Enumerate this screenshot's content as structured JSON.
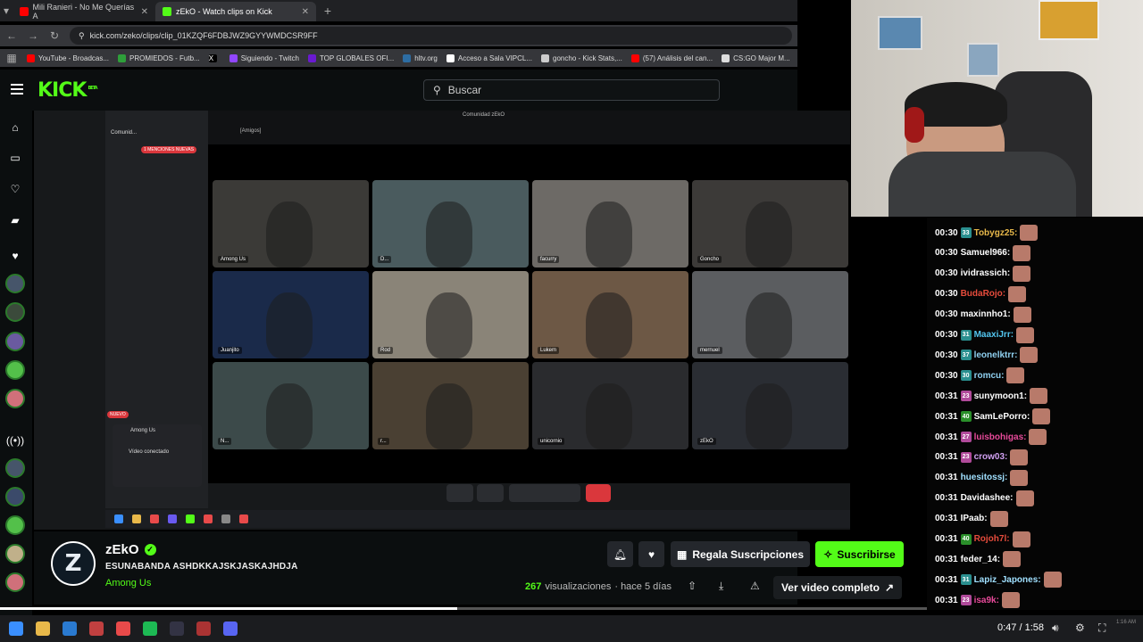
{
  "browser": {
    "tabs": [
      {
        "title": "Mili Ranieri - No Me Querías A",
        "fav_color": "#ff0000",
        "active": false
      },
      {
        "title": "zEkO - Watch clips on Kick",
        "fav_color": "#53fc18",
        "active": true
      }
    ],
    "new_tab": "+",
    "url": "kick.com/zeko/clips/clip_01KZQF6FDBJWZ9GYYWMDCSR9FF",
    "bookmarks": [
      {
        "label": "YouTube - Broadcas...",
        "color": "#ff0000"
      },
      {
        "label": "PROMIEDOS - Futb...",
        "color": "#2e9f3a"
      },
      {
        "label": "",
        "color": "#000000",
        "icon": "x-icon"
      },
      {
        "label": "Siguiendo - Twitch",
        "color": "#9146ff"
      },
      {
        "label": "TOP GLOBALES OFI...",
        "color": "#6a1ad1"
      },
      {
        "label": "hltv.org",
        "color": "#2d6da3"
      },
      {
        "label": "Acceso a Sala VIPCL...",
        "color": "#ffffff"
      },
      {
        "label": "goncho - Kick Stats,...",
        "color": "#cccccc"
      },
      {
        "label": "(57) Análisis del can...",
        "color": "#ff0000"
      },
      {
        "label": "CS:GO Major M...",
        "color": "#dddddd"
      }
    ]
  },
  "kick": {
    "logo": "KICK",
    "logo_sup": "BETA",
    "search_placeholder": "Buscar"
  },
  "discord": {
    "top_center": "Comunidad zEkO",
    "top_left": "[Amigos]",
    "server": "Comunid...",
    "new_mentions": "1 MENCIONES NUEVAS",
    "new_badge": "NUEVO",
    "voice_channel": "Among Us",
    "voice_status": "Vídeo conectado",
    "tiles": [
      {
        "name": "Among Us",
        "bg": "#3b3a37"
      },
      {
        "name": "D...",
        "bg": "#4a5b5e"
      },
      {
        "name": "facurry",
        "bg": "#6d6a66"
      },
      {
        "name": "Goncho",
        "bg": "#3c3a38"
      },
      {
        "name": "Juanjito",
        "bg": "#1a2a4a"
      },
      {
        "name": "Rod",
        "bg": "#8a8478"
      },
      {
        "name": "Lukem",
        "bg": "#6d5845"
      },
      {
        "name": "mernuel",
        "bg": "#5b5d60"
      },
      {
        "name": "N...",
        "bg": "#3c4a4a"
      },
      {
        "name": "r...",
        "bg": "#4a4033"
      },
      {
        "name": "unicornio",
        "bg": "#2a2b2e"
      },
      {
        "name": "zEkO",
        "bg": "#2a2d33"
      }
    ]
  },
  "stream": {
    "channel": "zEkO",
    "title": "ESUNABANDA ASHDKKAJSKJASKAJHDJA",
    "category": "Among Us",
    "gift_label": "Regala Suscripciones",
    "subscribe_label": "Suscribirse",
    "views_count": "267",
    "views_label": "visualizaciones",
    "age": "· hace 5 días",
    "full_video_label": "Ver video completo",
    "progress": 0.4
  },
  "player": {
    "timecode": "0:47 / 1:58",
    "clock": "1:16 AM"
  },
  "chat": [
    {
      "time": "00:30",
      "badge": "33",
      "badge_color": "#2a8f8f",
      "user": "Tobygz25:",
      "color": "#e8b84a",
      "emote": true
    },
    {
      "time": "00:30",
      "badge": "",
      "badge_color": "",
      "user": "Samuel966:",
      "color": "#ffffff",
      "emote": true
    },
    {
      "time": "00:30",
      "badge": "",
      "badge_color": "",
      "user": "ividrassich:",
      "color": "#ffffff",
      "emote": true
    },
    {
      "time": "00:30",
      "badge": "",
      "badge_color": "",
      "user": "BudaRojo:",
      "color": "#e74c3c",
      "emote": true
    },
    {
      "time": "00:30",
      "badge": "",
      "badge_color": "",
      "user": "maxinnho1:",
      "color": "#ffffff",
      "emote": true
    },
    {
      "time": "00:30",
      "badge": "31",
      "badge_color": "#2a8f8f",
      "user": "MaaxiJrr:",
      "color": "#53c6f0",
      "emote": true
    },
    {
      "time": "00:30",
      "badge": "37",
      "badge_color": "#2a8f8f",
      "user": "leonelktrr:",
      "color": "#8fd0f0",
      "emote": true
    },
    {
      "time": "00:30",
      "badge": "30",
      "badge_color": "#2a8f8f",
      "user": "romcu:",
      "color": "#8fd0f0",
      "emote": true
    },
    {
      "time": "00:31",
      "badge": "23",
      "badge_color": "#b04a9a",
      "user": "sunymoon1:",
      "color": "#ffffff",
      "emote": true
    },
    {
      "time": "00:31",
      "badge": "40",
      "badge_color": "#2a8f2a",
      "user": "SamLePorro:",
      "color": "#ffffff",
      "emote": true
    },
    {
      "time": "00:31",
      "badge": "27",
      "badge_color": "#b04a9a",
      "user": "luisbohigas:",
      "color": "#e84a9a",
      "emote": true
    },
    {
      "time": "00:31",
      "badge": "23",
      "badge_color": "#b04a9a",
      "user": "crow03:",
      "color": "#d0a0f0",
      "emote": true
    },
    {
      "time": "00:31",
      "badge": "",
      "badge_color": "",
      "user": "huesitossj:",
      "color": "#a0e0ff",
      "emote": true
    },
    {
      "time": "00:31",
      "badge": "",
      "badge_color": "",
      "user": "Davidashee:",
      "color": "#ffffff",
      "emote": true
    },
    {
      "time": "00:31",
      "badge": "",
      "badge_color": "",
      "user": "IPaab:",
      "color": "#ffffff",
      "emote": true
    },
    {
      "time": "00:31",
      "badge": "40",
      "badge_color": "#2a8f2a",
      "user": "Rojoh7l:",
      "color": "#e74c3c",
      "emote": true
    },
    {
      "time": "00:31",
      "badge": "",
      "badge_color": "",
      "user": "feder_14:",
      "color": "#ffffff",
      "emote": true
    },
    {
      "time": "00:31",
      "badge": "31",
      "badge_color": "#2a8f8f",
      "user": "Lapiz_Japones:",
      "color": "#a0e0ff",
      "emote": true
    },
    {
      "time": "00:31",
      "badge": "23",
      "badge_color": "#b04a9a",
      "user": "isa9k:",
      "color": "#e84a9a",
      "emote": true
    }
  ],
  "colors": {
    "accent": "#53fc18",
    "bg": "#0b0e0f"
  }
}
